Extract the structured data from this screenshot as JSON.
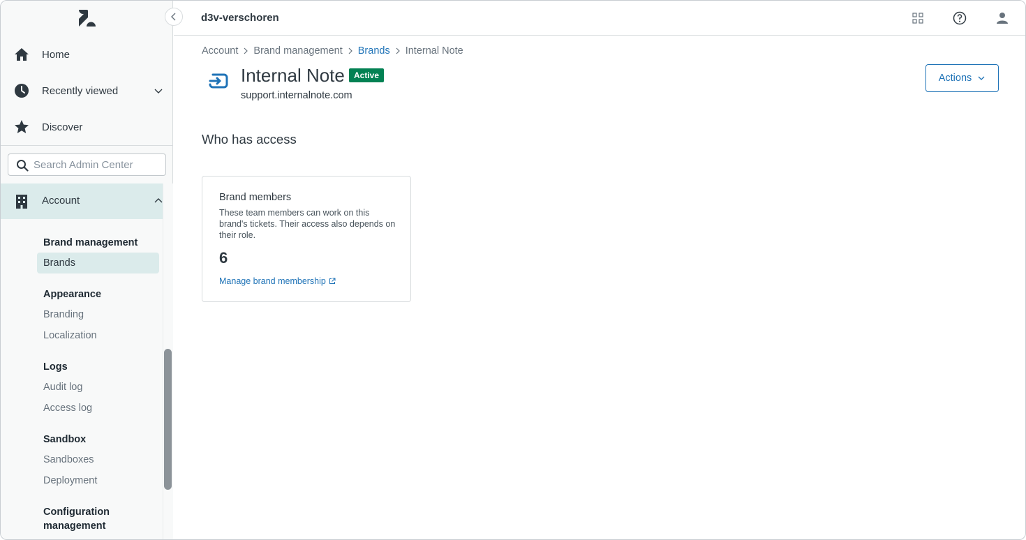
{
  "sidebar": {
    "top_items": [
      {
        "label": "Home",
        "icon": "home-icon"
      },
      {
        "label": "Recently viewed",
        "icon": "clock-icon"
      },
      {
        "label": "Discover",
        "icon": "star-icon"
      }
    ],
    "search": {
      "placeholder": "Search Admin Center",
      "value": ""
    },
    "account": {
      "label": "Account",
      "icon": "building-icon"
    },
    "groups": {
      "brand_management": {
        "title": "Brand management",
        "items": [
          "Brands"
        ]
      },
      "appearance": {
        "title": "Appearance",
        "items": [
          "Branding",
          "Localization"
        ]
      },
      "logs": {
        "title": "Logs",
        "items": [
          "Audit log",
          "Access log"
        ]
      },
      "sandbox": {
        "title": "Sandbox",
        "items": [
          "Sandboxes",
          "Deployment"
        ]
      },
      "configuration": {
        "title_line1": "Configuration",
        "title_line2": "management"
      }
    },
    "active_item": "Brands"
  },
  "header": {
    "account_name": "d3v-verschoren",
    "icons": [
      "apps-grid-icon",
      "help-icon",
      "user-icon"
    ]
  },
  "breadcrumb": [
    "Account",
    "Brand management",
    "Brands",
    "Internal Note"
  ],
  "brand": {
    "name": "Internal Note",
    "status": "Active",
    "url": "support.internalnote.com",
    "actions_label": "Actions"
  },
  "access": {
    "section_title": "Who has access",
    "card": {
      "title": "Brand members",
      "description": "These team members can work on this brand's tickets. Their access also depends on their role.",
      "count": "6",
      "link_label": "Manage brand membership"
    }
  },
  "colors": {
    "accent": "#1f73b7",
    "active_badge": "#038153",
    "sidebar_active_bg": "#dbebeb",
    "icon_dark": "#2f3941"
  }
}
